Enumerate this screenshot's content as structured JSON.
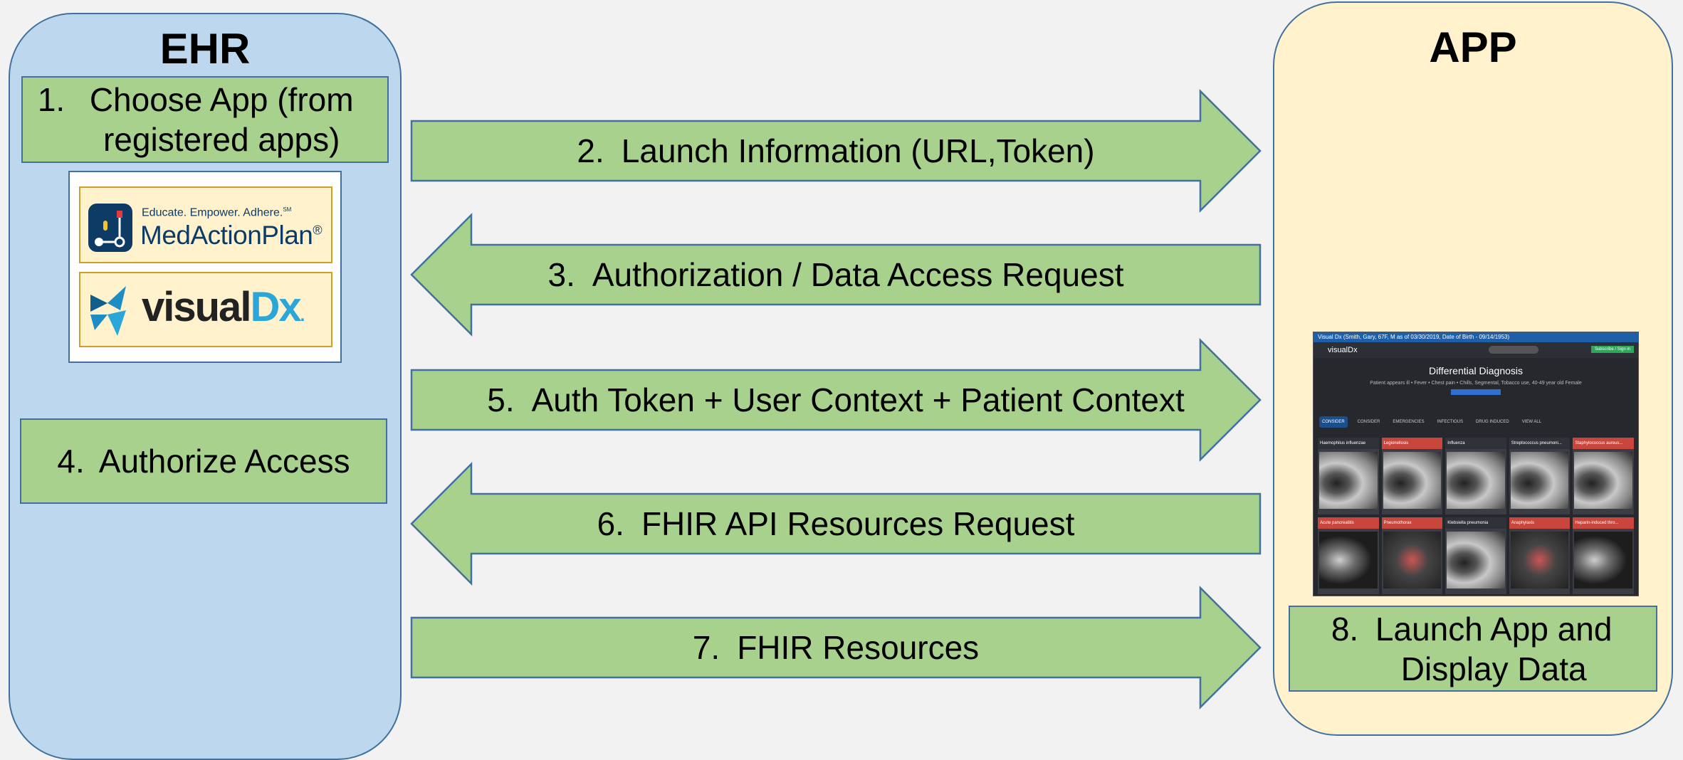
{
  "ehr": {
    "title": "EHR",
    "step1": {
      "num": "1.",
      "text": "Choose App (from registered apps)"
    },
    "step4": {
      "num": "4.",
      "text": "Authorize Access"
    },
    "logos": {
      "medaction_tagline": "Educate. Empower. Adhere.",
      "medaction_tagline_mark": "SM",
      "medaction_name": "MedActionPlan",
      "medaction_mark": "®",
      "visualdx_prefix": "visual",
      "visualdx_suffix": "Dx",
      "visualdx_dot": "."
    }
  },
  "app": {
    "title": "APP",
    "step8": {
      "num": "8.",
      "text": "Launch App and Display Data"
    },
    "screenshot": {
      "header_bar": "Visual Dx (Smith, Gary, 67F, M as of 03/30/2019, Date of Birth - 09/14/1953)",
      "logo": "visualDx",
      "subscribe": "Subscribe / Sign in",
      "title": "Differential Diagnosis",
      "subtitle": "Patient appears ill • Fever • Chest pain • Chills, Segmental, Tobacco use, 40-49 year old Female",
      "tabs": [
        "CONSIDER",
        "CONSIDER",
        "EMERGENCIES",
        "INFECTIOUS",
        "DRUG INDUCED",
        "VIEW ALL"
      ],
      "cards": [
        {
          "label": "Haemophilus influenzae",
          "alert": false,
          "img": "lung"
        },
        {
          "label": "Legionellosis",
          "alert": true,
          "img": "lung"
        },
        {
          "label": "Influenza",
          "alert": false,
          "img": "lung"
        },
        {
          "label": "Streptococcus pneumoni...",
          "alert": false,
          "img": "lung"
        },
        {
          "label": "Staphylococcus aureus...",
          "alert": true,
          "img": "lung"
        },
        {
          "label": "Acute pancreatitis",
          "alert": true,
          "img": "ct"
        },
        {
          "label": "Pneumothorax",
          "alert": true,
          "img": "diagram"
        },
        {
          "label": "Klebsiella pneumonia",
          "alert": false,
          "img": "lung"
        },
        {
          "label": "Anaphylaxis",
          "alert": true,
          "img": "diagram"
        },
        {
          "label": "Heparin-induced thro...",
          "alert": true,
          "img": "ct"
        }
      ]
    }
  },
  "arrows": [
    {
      "num": "2.",
      "text": "Launch Information (URL,Token)",
      "direction": "right"
    },
    {
      "num": "3.",
      "text": "Authorization / Data Access Request",
      "direction": "left"
    },
    {
      "num": "5.",
      "text": "Auth Token + User Context + Patient Context",
      "direction": "right"
    },
    {
      "num": "6.",
      "text": "FHIR API Resources Request",
      "direction": "left"
    },
    {
      "num": "7.",
      "text": "FHIR Resources",
      "direction": "right"
    }
  ],
  "colors": {
    "ehr_panel": "#bdd7ee",
    "app_panel": "#fff2cc",
    "step_fill": "#a9d18e",
    "outline": "#41719c"
  }
}
